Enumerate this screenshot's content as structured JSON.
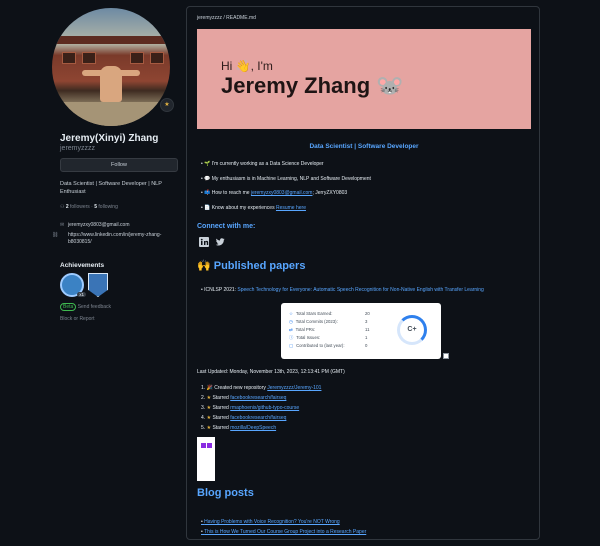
{
  "profile": {
    "name": "Jeremy(Xinyi) Zhang",
    "username": "jeremyzzzz",
    "status_emoji": "★",
    "follow_label": "Follow",
    "bio": "Data Scientist | Software Developer | NLP Enthusiast",
    "followers_count": "2",
    "followers_label": "followers",
    "following_count": "5",
    "following_label": "following",
    "email": "jeremyzxy0803@gmail.com",
    "linkedin": "https://www.linkedin.com/in/jeremy-zhang-b8030815/",
    "achievements_title": "Achievements",
    "achievement_multiplier": "x1",
    "beta_label": "Beta",
    "beta_text": "Send feedback",
    "block_label": "Block or Report"
  },
  "readme": {
    "breadcrumb": "jeremyzzzz / README.md",
    "banner_hi": "Hi 👋, I'm",
    "banner_name": "Jeremy Zhang 🐭",
    "role": "Data Scientist | Software Developer",
    "about": [
      {
        "icon": "🌱",
        "text": "I'm currently working as a Data Science Developer",
        "link": ""
      },
      {
        "icon": "💬",
        "text": "My enthusiasm is in Machine Learning, NLP and Software Development",
        "link": ""
      },
      {
        "icon": "📫",
        "text": "How to reach me",
        "link": "jeremyzxy0803@gmail.com",
        "extra": "; JerryZXY0803"
      },
      {
        "icon": "📄",
        "text": "Know about my experiences",
        "link": "Resume here"
      }
    ],
    "connect_label": "Connect with me:",
    "papers_heading": "🙌 Published papers",
    "paper_prefix": "ICNLSP 2021:",
    "paper_link": "Speech Technology for Everyone: Automatic Speech Recognition for Non-Native English with Transfer Learning",
    "stats": {
      "rows": [
        {
          "icon": "☆",
          "label": "Total Stars Earned:",
          "value": "20"
        },
        {
          "icon": "◷",
          "label": "Total Commits (2023):",
          "value": "3"
        },
        {
          "icon": "⇄",
          "label": "Total PRs:",
          "value": "11"
        },
        {
          "icon": "ⓘ",
          "label": "Total Issues:",
          "value": "1"
        },
        {
          "icon": "▢",
          "label": "Contributed to (last year):",
          "value": "0"
        }
      ],
      "grade": "C+"
    },
    "updated": "Last Updated: Monday, November 13th, 2023, 12:13:41 PM (GMT)",
    "activity": [
      {
        "n": "1.",
        "icon": "🎉",
        "text": "Created new repository",
        "link": "Jeremyzzzz/Jeremy-101"
      },
      {
        "n": "2.",
        "icon": "★",
        "text": "Starred",
        "link": "facebookresearch/fairseq"
      },
      {
        "n": "3.",
        "icon": "★",
        "text": "Starred",
        "link": "rmaphoenix/github-typo-course"
      },
      {
        "n": "4.",
        "icon": "★",
        "text": "Starred",
        "link": "facebookresearch/fairseq"
      },
      {
        "n": "5.",
        "icon": "★",
        "text": "Starred",
        "link": "mozilla/DeepSpeech"
      }
    ],
    "blog_heading": "Blog posts",
    "blog": [
      "Having Problems with Voice Recognition? You're NOT Wrong",
      "This is How We Turned Our Course Group Project into a Research Paper"
    ]
  },
  "colors": {
    "accent": "#58a6ff",
    "banner": "#e5a4a1",
    "background": "#0d1117"
  }
}
